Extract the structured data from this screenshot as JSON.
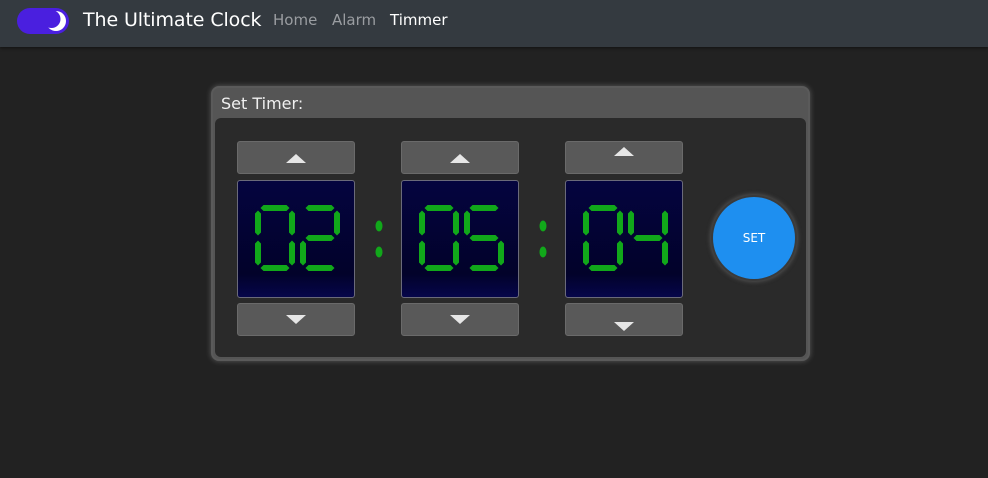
{
  "navbar": {
    "brand": "The Ultimate Clock",
    "links": [
      {
        "label": "Home",
        "active": false
      },
      {
        "label": "Alarm",
        "active": false
      },
      {
        "label": "Timmer",
        "active": true
      }
    ]
  },
  "timer": {
    "title": "Set Timer:",
    "hours": "02",
    "minutes": "05",
    "seconds": "04",
    "separator": ":",
    "set_label": "SET"
  },
  "colors": {
    "toggle": "#4a1fdf",
    "segment": "#11a81a",
    "set_button": "#1e8ff0",
    "digit_background": "#04043f"
  },
  "icons": {
    "toggle_icon": "moon-icon",
    "up": "arrow-up-icon",
    "down": "arrow-down-icon"
  }
}
